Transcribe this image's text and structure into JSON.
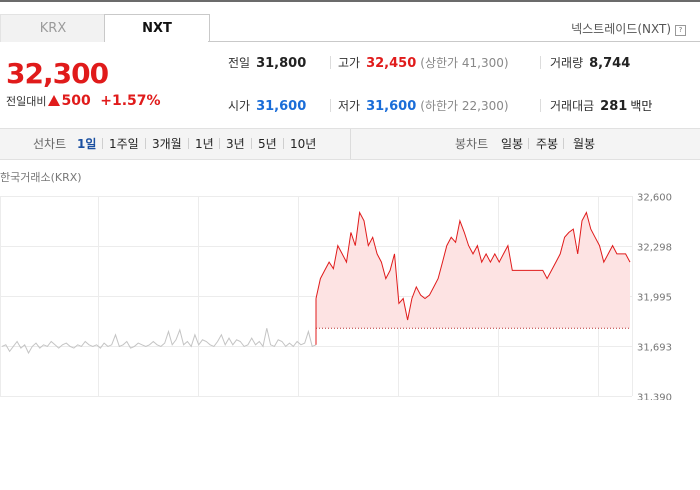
{
  "tabs": {
    "krx": "KRX",
    "nxt": "NXT"
  },
  "exchange": {
    "label": "넥스트레이드(NXT)",
    "help_icon": "?"
  },
  "price": {
    "current": "32,300",
    "change_label": "전일대비",
    "change_value": "500",
    "change_pct": "+1.57%"
  },
  "stats": {
    "prev_close": {
      "label": "전일",
      "value": "31,800"
    },
    "high": {
      "label": "고가",
      "value": "32,450",
      "limit_label": "(상한가 41,300)"
    },
    "volume": {
      "label": "거래량",
      "value": "8,744"
    },
    "open": {
      "label": "시가",
      "value": "31,600"
    },
    "low": {
      "label": "저가",
      "value": "31,600",
      "limit_label": "(하한가 22,300)"
    },
    "amount": {
      "label": "거래대금",
      "value": "281",
      "unit": "백만"
    }
  },
  "period_bar": {
    "line_label": "선차트",
    "line_periods": [
      "1일",
      "1주일",
      "3개월",
      "1년",
      "3년",
      "5년",
      "10년"
    ],
    "active_period": "1일",
    "candle_label": "봉차트",
    "candle_periods": [
      "일봉",
      "주봉",
      "월봉"
    ]
  },
  "chart_source_label": "한국거래소(KRX)",
  "colors": {
    "up": "#e01b1b",
    "down": "#1a6dd8",
    "active": "#1a4fa0",
    "area_fill": "#fde3e3",
    "line_gray": "#c4c4c4"
  },
  "chart_data": {
    "type": "line",
    "ylim": [
      31390,
      32600
    ],
    "y_ticks": [
      "32,600",
      "32,298",
      "31,995",
      "31,693",
      "31,390"
    ],
    "y_tick_values": [
      32600,
      32298,
      31995,
      31693,
      31390
    ],
    "reference_value": 31800,
    "series": [
      {
        "values": [
          31690,
          31700,
          31660,
          31690,
          31720,
          31680,
          31700,
          31650,
          31690,
          31710,
          31680,
          31700,
          31690,
          31720,
          31700,
          31680,
          31700,
          31710,
          31690,
          31680,
          31700,
          31690,
          31720,
          31700,
          31690,
          31700,
          31680,
          31710,
          31690,
          31700,
          31760,
          31690,
          31700,
          31720,
          31680,
          31690,
          31710,
          31700,
          31690,
          31700,
          31720,
          31700,
          31690,
          31710,
          31780,
          31700,
          31730,
          31790,
          31700,
          31720,
          31690,
          31760,
          31700,
          31730,
          31720,
          31700,
          31690,
          31720,
          31760,
          31700,
          31740,
          31700,
          31730,
          31720,
          31690,
          31700,
          31740,
          31700,
          31720,
          31690,
          31800,
          31700,
          31690,
          31730,
          31720,
          31690,
          31710,
          31690,
          31720,
          31700,
          31710,
          31780,
          31690,
          31700
        ]
      },
      {
        "values": [
          31980,
          32100,
          32150,
          32200,
          32160,
          32300,
          32250,
          32200,
          32380,
          32300,
          32500,
          32450,
          32300,
          32350,
          32250,
          32200,
          32100,
          32150,
          32250,
          31950,
          31980,
          31850,
          31980,
          32050,
          32000,
          31980,
          32000,
          32050,
          32100,
          32200,
          32300,
          32350,
          32320,
          32450,
          32380,
          32300,
          32250,
          32300,
          32200,
          32250,
          32200,
          32250,
          32200,
          32250,
          32300,
          32150,
          32150,
          32150,
          32150,
          32150,
          32150,
          32150,
          32150,
          32100,
          32150,
          32200,
          32250,
          32350,
          32380,
          32400,
          32250,
          32450,
          32500,
          32400,
          32350,
          32300,
          32200,
          32250,
          32300,
          32250,
          32250,
          32250,
          32200
        ]
      }
    ]
  }
}
